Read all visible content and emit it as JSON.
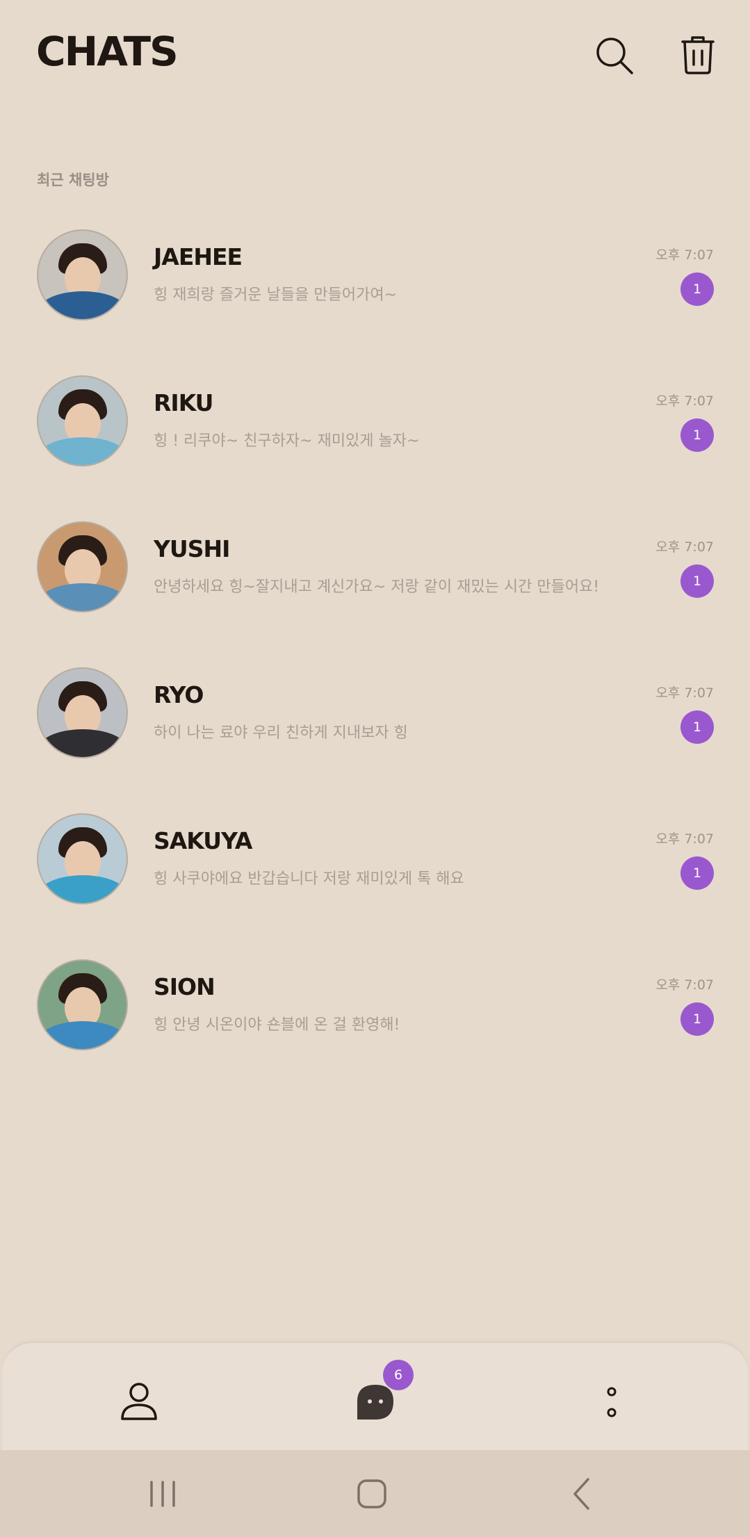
{
  "header": {
    "title": "CHATS",
    "icons": [
      "search-icon",
      "trash-icon"
    ]
  },
  "section": {
    "label": "최근 채팅방"
  },
  "chats": [
    {
      "name": "JAEHEE",
      "message": "힝 재희랑 즐거운 날들을 만들어가여~",
      "time": "오후 7:07",
      "unread": "1",
      "avatar_colors": [
        "#c8c3bc",
        "#2b5f94"
      ]
    },
    {
      "name": "RIKU",
      "message": "힝 ! 리쿠야~ 친구하자~ 재미있게 놀자~",
      "time": "오후 7:07",
      "unread": "1",
      "avatar_colors": [
        "#b9c4c9",
        "#6fb3cf"
      ]
    },
    {
      "name": "YUSHI",
      "message": "안녕하세요 힝~잘지내고 계신가요~ 저랑 같이 재밌는 시간 만들어요!",
      "time": "오후 7:07",
      "unread": "1",
      "avatar_colors": [
        "#c99a70",
        "#5a8fb8"
      ]
    },
    {
      "name": "RYO",
      "message": "하이 나는 료야 우리 친하게 지내보자 힝",
      "time": "오후 7:07",
      "unread": "1",
      "avatar_colors": [
        "#bcc0c4",
        "#2f2f33"
      ]
    },
    {
      "name": "SAKUYA",
      "message": "힝 사쿠야에요 반갑습니다 저랑 재미있게 톡 해요",
      "time": "오후 7:07",
      "unread": "1",
      "avatar_colors": [
        "#b9ccd6",
        "#3aa0c8"
      ]
    },
    {
      "name": "SION",
      "message": "힝 안녕 시온이야 숀블에 온 걸 환영해!",
      "time": "오후 7:07",
      "unread": "1",
      "avatar_colors": [
        "#7fa387",
        "#3d8ac0"
      ]
    }
  ],
  "bottom_nav": {
    "items": [
      "profile-icon",
      "chat-bubble-icon",
      "more-vertical-icon"
    ],
    "chat_badge": "6",
    "accent": "#9a58cf"
  },
  "system_nav": [
    "recents-icon",
    "home-icon",
    "back-icon"
  ],
  "colors": {
    "background": "#e6dacd",
    "accent": "#9a58cf",
    "text_primary": "#1e1712",
    "text_secondary": "#a89d93"
  }
}
